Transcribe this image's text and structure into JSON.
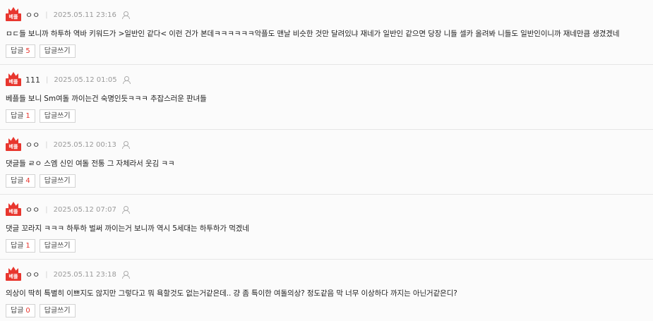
{
  "badge_label": "베플",
  "reply_label": "답글",
  "write_reply_label": "답글쓰기",
  "comments": [
    {
      "author": "ㅇㅇ",
      "date": "2025.05.11 23:16",
      "text": "ㅁㄷ들 보니까 하투하 역바 키워드가 >일반인 같다< 이런 건가 본데ㅋㅋㅋㅋㅋㅋ악플도 맨날 비슷한 것만 달려있냐 재네가 일반인 같으면 당장 니들 셀카 올려봐 니들도 일반인이니까 재네만큼 생겼겠네",
      "reply_count": "5"
    },
    {
      "author": "111",
      "date": "2025.05.12 01:05",
      "text": "베플들 보니 Sm여돌 까이는건 숙명인듯ㅋㅋㅋ 추잡스러운 판녀들",
      "reply_count": "1"
    },
    {
      "author": "ㅇㅇ",
      "date": "2025.05.12 00:13",
      "text": "댓글들 ㄹㅇ 스엠 신인 여돌 전통 그 자체라서 웃김 ㅋㅋ",
      "reply_count": "4"
    },
    {
      "author": "ㅇㅇ",
      "date": "2025.05.12 07:07",
      "text": "댓글 꼬라지 ㅋㅋㅋ 하투하 벌써 까이는거 보니까 역시 5세대는 하투하가 먹겠네",
      "reply_count": "1"
    },
    {
      "author": "ㅇㅇ",
      "date": "2025.05.11 23:18",
      "text": "의상이 딱히 특별히 이쁘지도 않지만 그렇다고 뭐 욕할것도 없는거같은데.. 걍 좀 특이한 여돌의상? 정도같음 막 너무 이상하다 까지는 아닌거같은디?",
      "reply_count": "0"
    }
  ]
}
